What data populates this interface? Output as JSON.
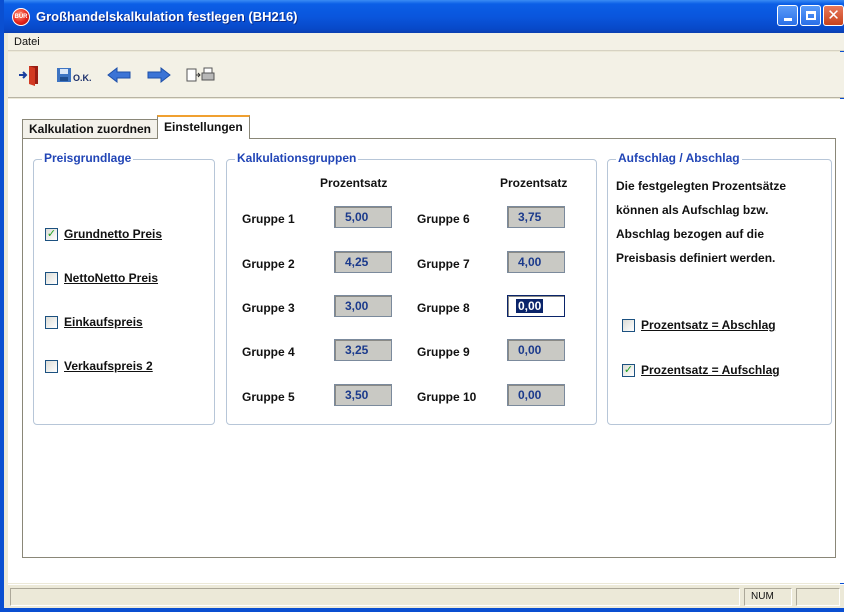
{
  "window": {
    "title": "Großhandelskalkulation festlegen (BH216)",
    "app_icon_text": "BÜR"
  },
  "menu": {
    "items": [
      "Datei"
    ]
  },
  "toolbar": {
    "ok_label": "O.K."
  },
  "tabs": [
    {
      "label": "Kalkulation zuordnen",
      "active": false
    },
    {
      "label": "Einstellungen",
      "active": true
    }
  ],
  "preisgrundlage": {
    "title": "Preisgrundlage",
    "options": [
      {
        "label": "Grundnetto Preis",
        "checked": true
      },
      {
        "label": "NettoNetto Preis",
        "checked": false
      },
      {
        "label": "Einkaufspreis",
        "checked": false
      },
      {
        "label": "Verkaufspreis 2",
        "checked": false
      }
    ]
  },
  "kalkulationsgruppen": {
    "title": "Kalkulationsgruppen",
    "col_header": "Prozentsatz",
    "left": [
      {
        "label": "Gruppe 1",
        "value": "5,00"
      },
      {
        "label": "Gruppe 2",
        "value": "4,25"
      },
      {
        "label": "Gruppe 3",
        "value": "3,00"
      },
      {
        "label": "Gruppe 4",
        "value": "3,25"
      },
      {
        "label": "Gruppe 5",
        "value": "3,50"
      }
    ],
    "right": [
      {
        "label": "Gruppe 6",
        "value": "3,75"
      },
      {
        "label": "Gruppe 7",
        "value": "4,00"
      },
      {
        "label": "Gruppe 8",
        "value": "0,00",
        "focused": true
      },
      {
        "label": "Gruppe 9",
        "value": "0,00"
      },
      {
        "label": "Gruppe 10",
        "value": "0,00"
      }
    ]
  },
  "aufschlag": {
    "title": "Aufschlag / Abschlag",
    "description": [
      "Die festgelegten Prozentsätze",
      "können als Aufschlag bzw.",
      "Abschlag bezogen auf die",
      "Preisbasis definiert werden."
    ],
    "options": [
      {
        "label": "Prozentsatz = Abschlag",
        "checked": false
      },
      {
        "label": "Prozentsatz =  Aufschlag",
        "checked": true
      }
    ]
  },
  "statusbar": {
    "num": "NUM"
  },
  "colors": {
    "title_bar": "#0a56dd",
    "legend_text": "#2145b6",
    "tab_accent": "#f0a030",
    "check_mark": "#21a121"
  }
}
